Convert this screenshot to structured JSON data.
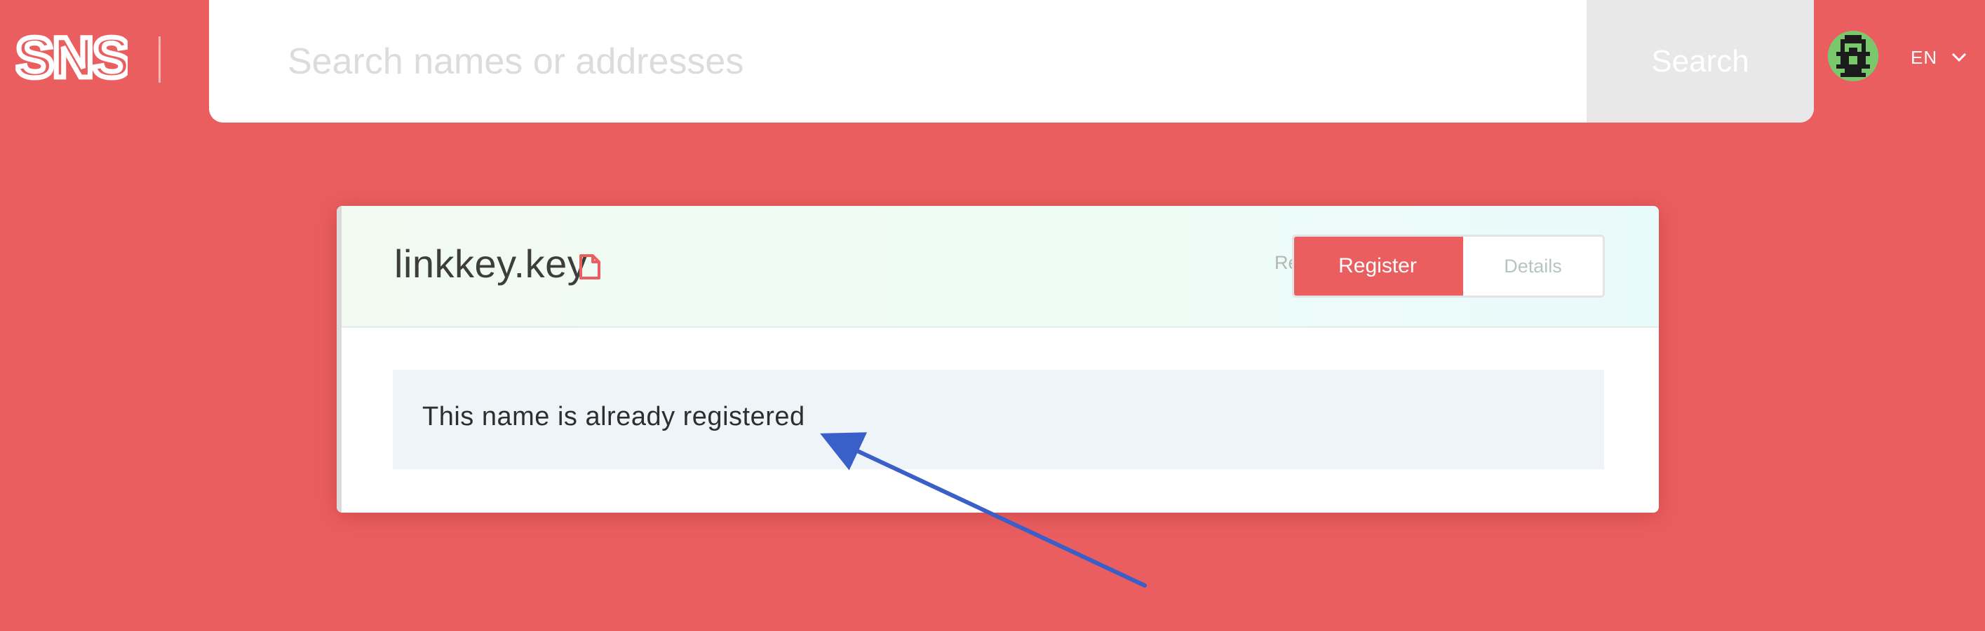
{
  "header": {
    "logo_text": "SNS",
    "search": {
      "placeholder": "Search names or addresses",
      "value": "",
      "button_label": "Search"
    },
    "language": "EN"
  },
  "domain": {
    "name": "linkkey.key",
    "tabs": {
      "registrant_label": "Registrant",
      "register_label": "Register",
      "details_label": "Details",
      "active": "Register"
    },
    "notice": "This name is already registered"
  },
  "icons": {
    "logo": "sns-logo",
    "avatar": "pixel-avatar-icon",
    "language_chevron": "chevron-down-icon",
    "document": "document-icon",
    "annotation": "arrow-annotation"
  },
  "colors": {
    "background": "#ea5e5f",
    "accent": "#ea5e5f",
    "card_header_gradient_start": "#f1faf1",
    "card_header_gradient_end": "#e9fafb",
    "notice_background": "#eef4f8",
    "annotation_arrow": "#3a5fc8"
  }
}
